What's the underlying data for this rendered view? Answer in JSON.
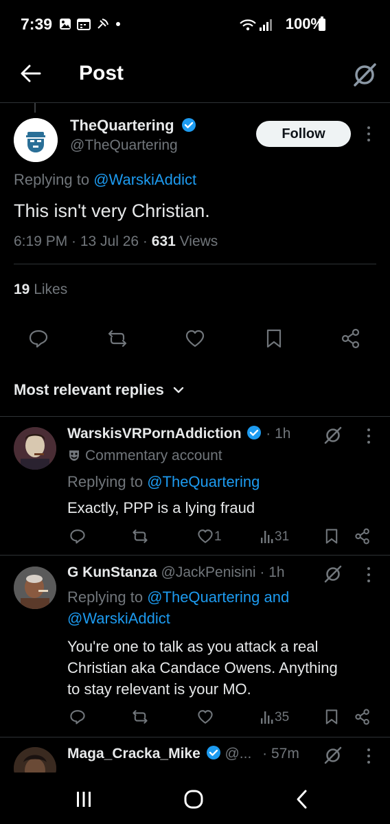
{
  "status": {
    "time": "7:39",
    "battery": "100%"
  },
  "header": {
    "title": "Post"
  },
  "post": {
    "author_name": "TheQuartering",
    "author_handle": "@TheQuartering",
    "follow_label": "Follow",
    "replying_prefix": "Replying to ",
    "replying_to": "@WarskiAddict",
    "text": "This isn't very Christian.",
    "time_date": "6:19 PM · 13 Jul 26 · ",
    "views_count": "631",
    "views_label": " Views",
    "likes_count": "19",
    "likes_label": " Likes"
  },
  "replies_header": {
    "label": "Most relevant replies"
  },
  "replies": [
    {
      "name": "WarskisVRPornAddiction",
      "time": "· 1h",
      "badge": "Commentary account",
      "replying_prefix": "Replying to ",
      "replying_to": "@TheQuartering",
      "text": "Exactly, PPP is a lying fraud",
      "likes": "1",
      "views": "31"
    },
    {
      "name": "G KunStanza",
      "handle": "@JackPenisini",
      "time": "· 1h",
      "replying_prefix": "Replying to ",
      "replying_to": "@TheQuartering and",
      "replying_to_2": "@WarskiAddict",
      "text_line1": "You're one to talk as you attack a real",
      "text_line2": "Christian aka Candace Owens. Anything",
      "text_line3": "to stay relevant is your MO.",
      "views": "35"
    },
    {
      "name": "Maga_Cracka_Mike",
      "handle": "@...",
      "time": "· 57m"
    }
  ],
  "colors": {
    "accent": "#1d9bf0",
    "muted": "#71767b",
    "background": "#000000"
  }
}
